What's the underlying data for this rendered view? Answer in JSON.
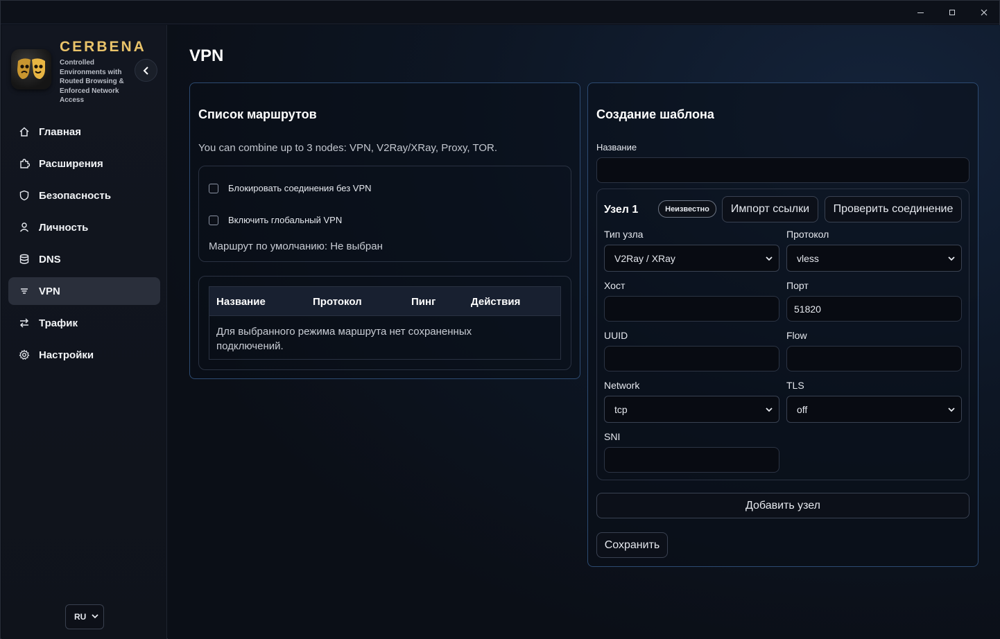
{
  "window": {
    "controls": {
      "minimize": "–",
      "maximize": "□",
      "close": "✕"
    }
  },
  "sidebar": {
    "brand_title": "CERBENA",
    "brand_subtitle": "Controlled Environments with Routed Browsing & Enforced Network Access",
    "items": [
      {
        "label": "Главная",
        "icon": "home-icon"
      },
      {
        "label": "Расширения",
        "icon": "puzzle-icon"
      },
      {
        "label": "Безопасность",
        "icon": "shield-icon"
      },
      {
        "label": "Личность",
        "icon": "user-icon"
      },
      {
        "label": "DNS",
        "icon": "database-icon"
      },
      {
        "label": "VPN",
        "icon": "vpn-icon",
        "active": true
      },
      {
        "label": "Трафик",
        "icon": "traffic-icon"
      },
      {
        "label": "Настройки",
        "icon": "gear-icon"
      }
    ],
    "language": "RU"
  },
  "page": {
    "title": "VPN"
  },
  "routes_card": {
    "title": "Список маршрутов",
    "hint": "You can combine up to 3 nodes: VPN, V2Ray/XRay, Proxy, TOR.",
    "block_without_vpn": "Блокировать соединения без VPN",
    "global_vpn": "Включить глобальный VPN",
    "default_route": "Маршрут по умолчанию: Не выбран",
    "table": {
      "columns": [
        "Название",
        "Протокол",
        "Пинг",
        "Действия"
      ],
      "empty": "Для выбранного режима маршрута нет сохраненных подключений."
    }
  },
  "template_card": {
    "title": "Создание шаблона",
    "name_label": "Название",
    "name_value": "",
    "node": {
      "title": "Узел 1",
      "status_badge": "Неизвестно",
      "import_button": "Импорт ссылки",
      "check_button": "Проверить соединение",
      "type_label": "Тип узла",
      "type_value": "V2Ray / XRay",
      "protocol_label": "Протокол",
      "protocol_value": "vless",
      "host_label": "Хост",
      "host_value": "",
      "port_label": "Порт",
      "port_value": "51820",
      "uuid_label": "UUID",
      "uuid_value": "",
      "flow_label": "Flow",
      "flow_value": "",
      "network_label": "Network",
      "network_value": "tcp",
      "tls_label": "TLS",
      "tls_value": "off",
      "sni_label": "SNI",
      "sni_value": ""
    },
    "add_node_button": "Добавить узел",
    "save_button": "Сохранить"
  },
  "colors": {
    "accent_gold": "#e9c36a",
    "card_border": "#2d4b72",
    "active_nav_bg": "#2a2f3b"
  }
}
